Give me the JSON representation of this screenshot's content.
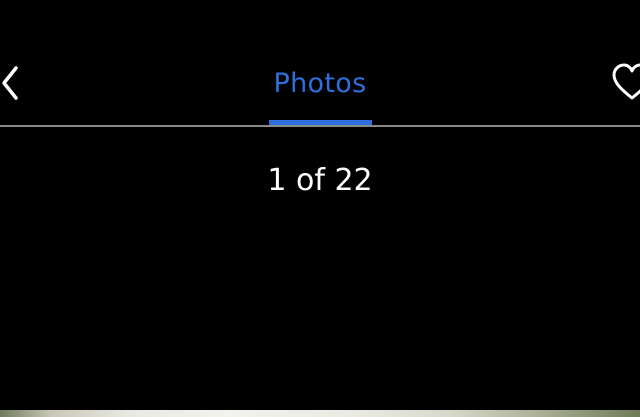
{
  "header": {
    "back_icon": "chevron-left-icon",
    "favorite_icon": "heart-outline-icon",
    "active_tab": {
      "label": "Photos"
    }
  },
  "gallery": {
    "counter": "1 of 22"
  },
  "colors": {
    "background": "#000000",
    "accent": "#2f6fdc",
    "text": "#ffffff",
    "divider": "#8a8a8a"
  }
}
